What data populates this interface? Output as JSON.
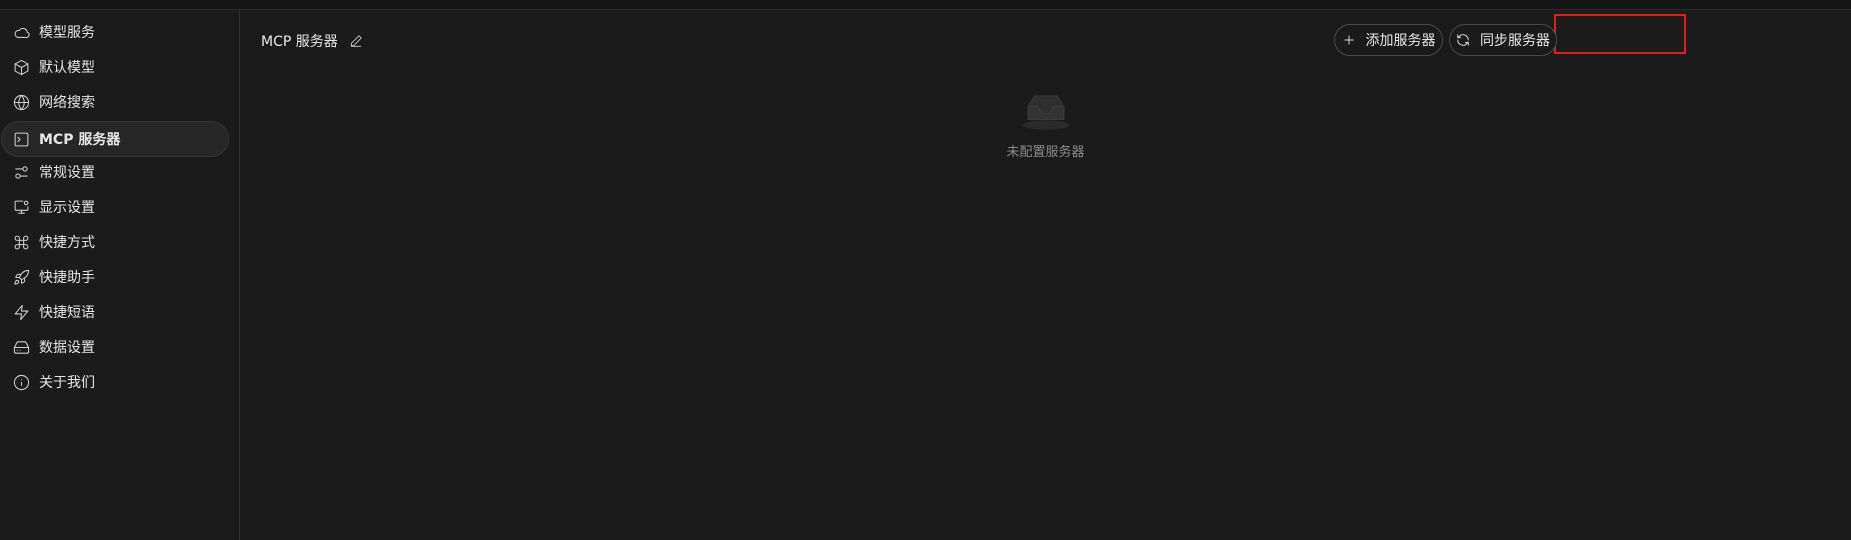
{
  "sidebar": {
    "items": [
      {
        "label": "模型服务",
        "icon": "cloud-icon",
        "active": false
      },
      {
        "label": "默认模型",
        "icon": "cube-icon",
        "active": false
      },
      {
        "label": "网络搜索",
        "icon": "globe-icon",
        "active": false
      },
      {
        "label": "MCP 服务器",
        "icon": "terminal-icon",
        "active": true
      },
      {
        "label": "常规设置",
        "icon": "sliders-icon",
        "active": false
      },
      {
        "label": "显示设置",
        "icon": "monitor-settings-icon",
        "active": false
      },
      {
        "label": "快捷方式",
        "icon": "command-icon",
        "active": false
      },
      {
        "label": "快捷助手",
        "icon": "rocket-icon",
        "active": false
      },
      {
        "label": "快捷短语",
        "icon": "zap-icon",
        "active": false
      },
      {
        "label": "数据设置",
        "icon": "hard-drive-icon",
        "active": false
      },
      {
        "label": "关于我们",
        "icon": "info-icon",
        "active": false
      }
    ]
  },
  "main": {
    "title": "MCP 服务器",
    "add_button_label": "添加服务器",
    "sync_button_label": "同步服务器",
    "empty_text": "未配置服务器"
  },
  "colors": {
    "background": "#1b1b1b",
    "highlight": "#e02020",
    "active_item_bg": "#262626"
  }
}
